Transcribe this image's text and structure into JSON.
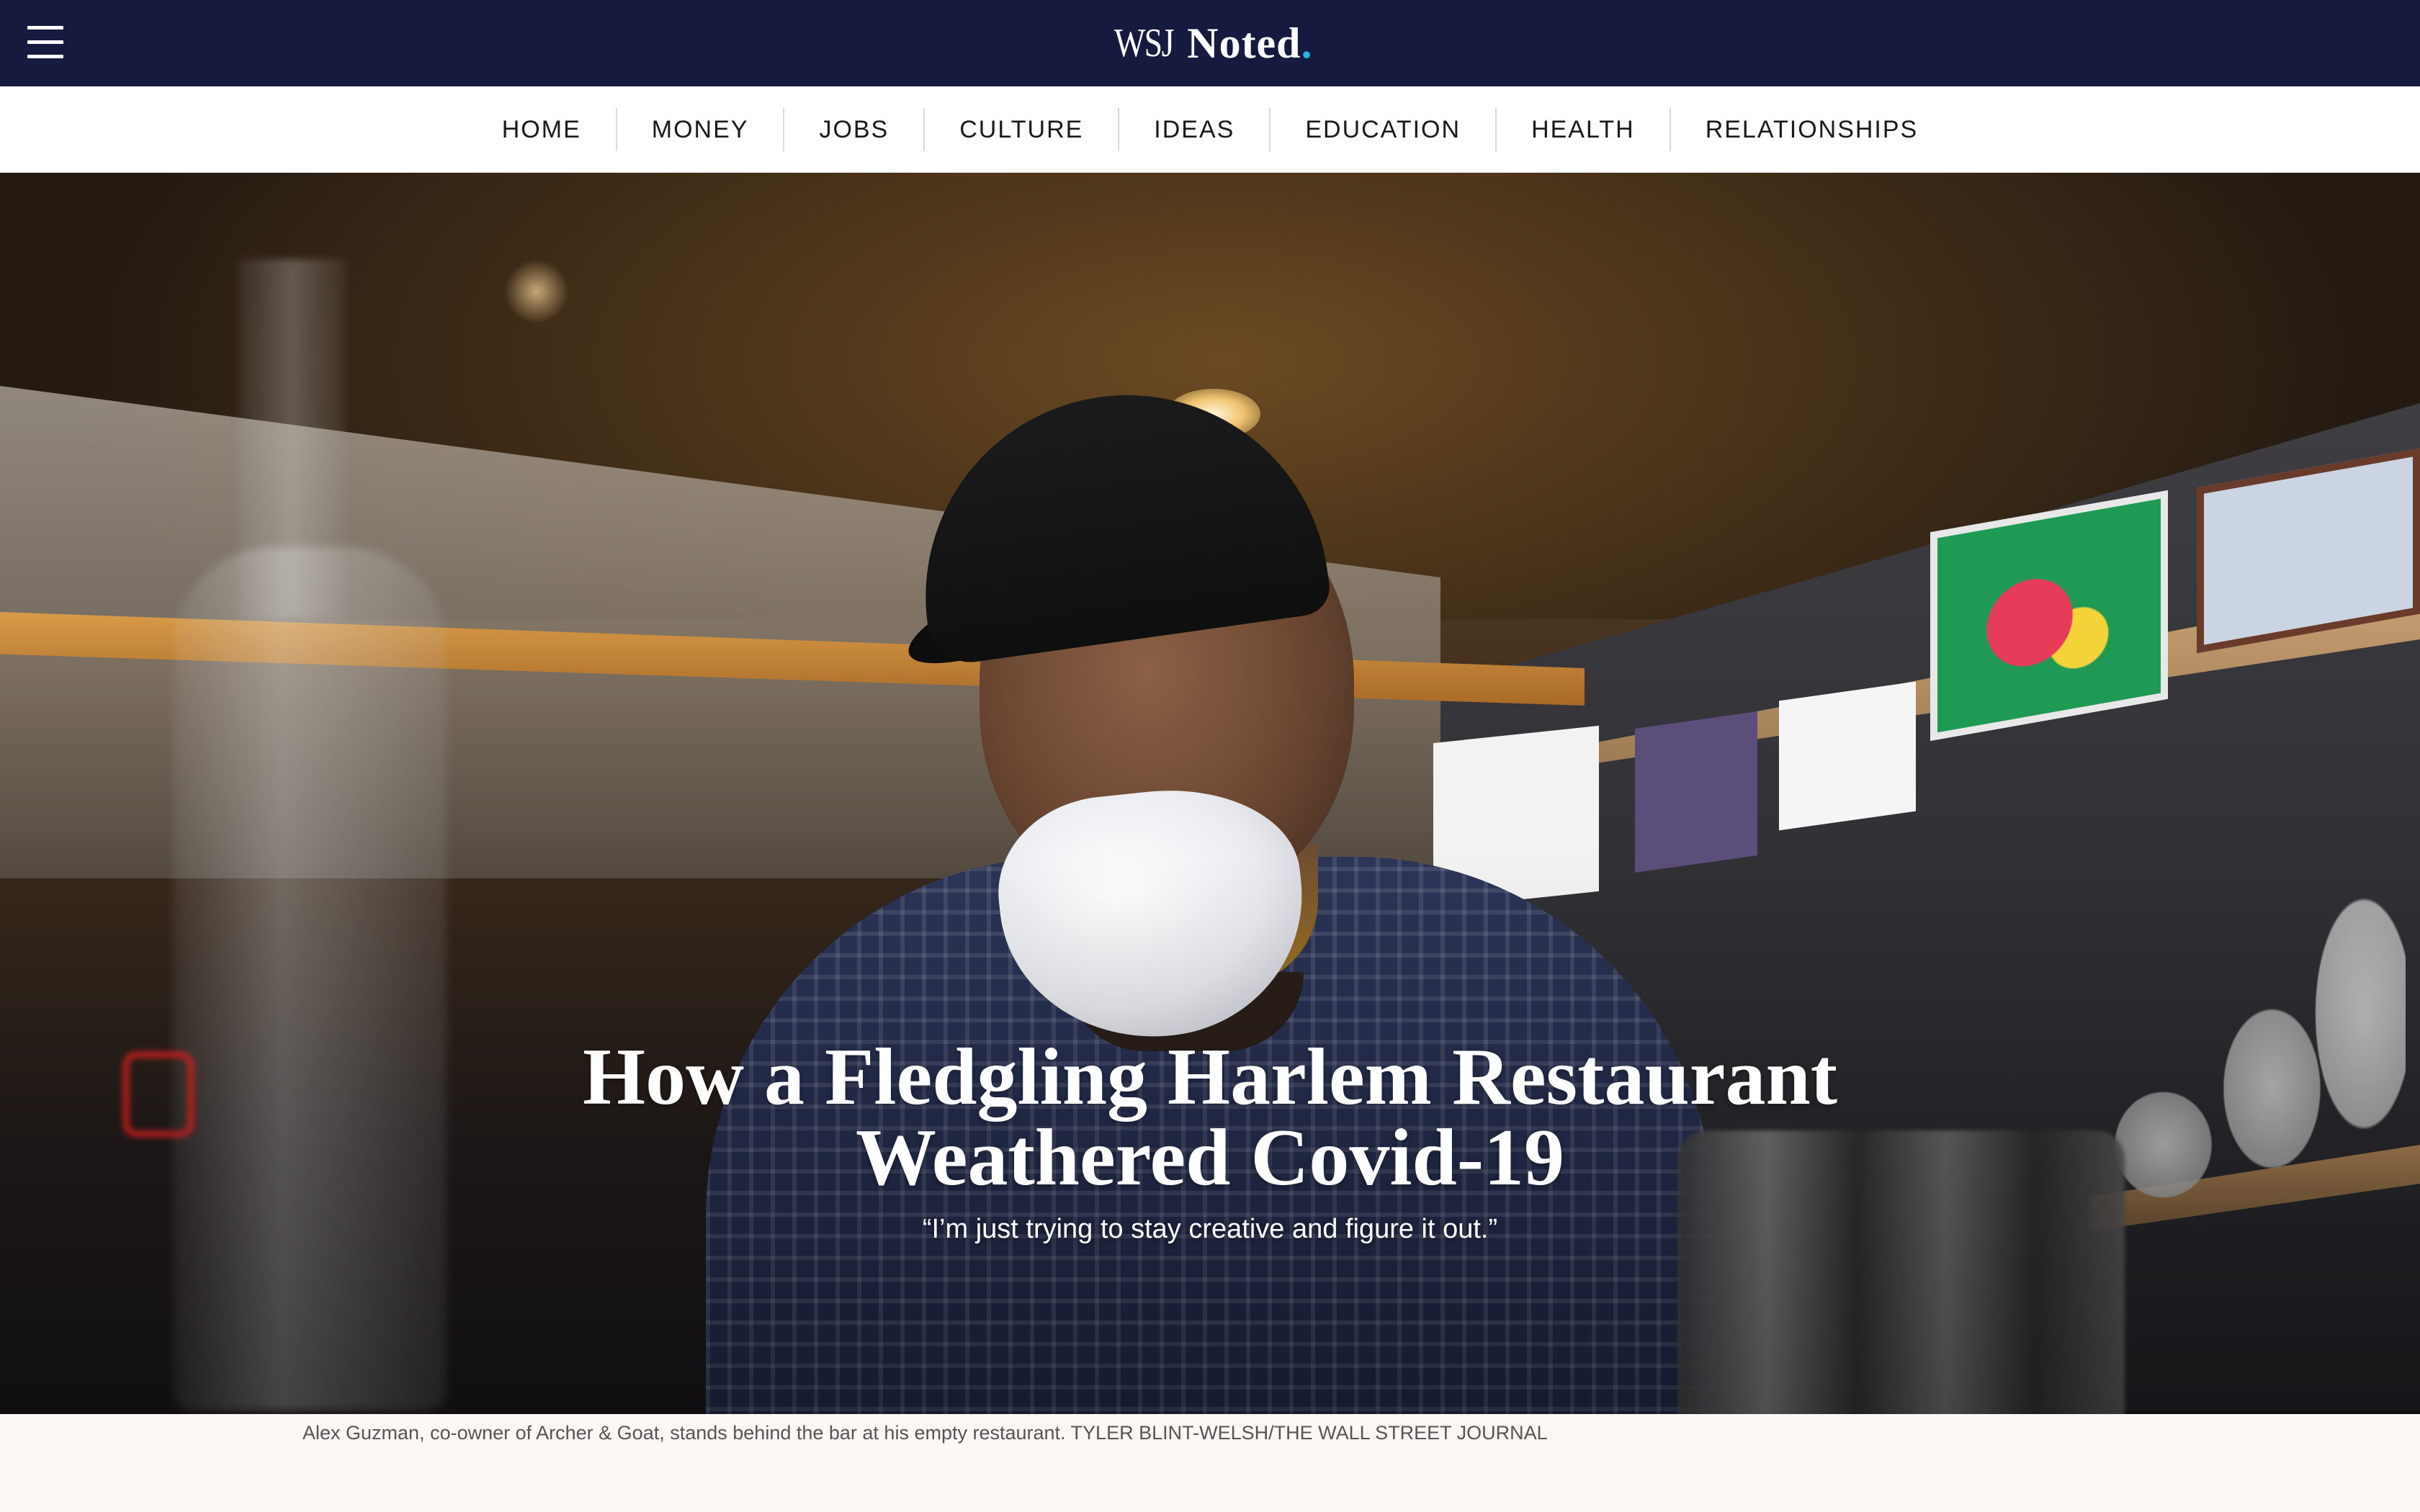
{
  "header": {
    "brand_wsj": "WSJ",
    "brand_noted": "Noted",
    "brand_dot": ".",
    "accent_color": "#2bb3d9",
    "background_color": "#161a3e",
    "menu_icon": "hamburger-menu-icon"
  },
  "nav": {
    "items": [
      {
        "label": "HOME"
      },
      {
        "label": "MONEY"
      },
      {
        "label": "JOBS"
      },
      {
        "label": "CULTURE"
      },
      {
        "label": "IDEAS"
      },
      {
        "label": "EDUCATION"
      },
      {
        "label": "HEALTH"
      },
      {
        "label": "RELATIONSHIPS"
      }
    ]
  },
  "article": {
    "headline_line1": "How a Fledgling Harlem Restaurant",
    "headline_line2": "Weathered Covid-19",
    "dek": "“I’m just trying to stay creative and figure it out.”",
    "caption": "Alex Guzman, co-owner of Archer & Goat, stands behind the bar at his empty restaurant. TYLER BLINT-WELSH/THE WALL STREET JOURNAL"
  }
}
